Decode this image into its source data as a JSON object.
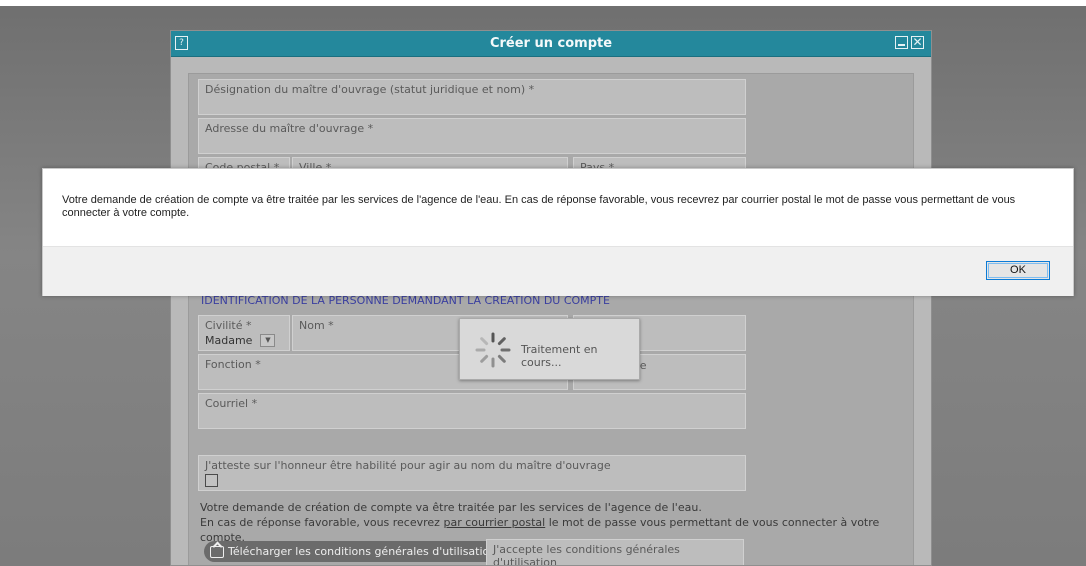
{
  "window": {
    "title": "Créer un compte",
    "help_glyph": "?",
    "close_glyph": "✕"
  },
  "form": {
    "designation_label": "Désignation du maître d'ouvrage (statut juridique et nom) *",
    "adresse_label": "Adresse du maître d'ouvrage *",
    "code_postal_label": "Code postal *",
    "ville_label": "Ville *",
    "pays_label": "Pays *",
    "section_identification": "IDENTIFICATION DE LA PERSONNE DEMANDANT LA CRÉATION DU COMPTE",
    "civilite_label": "Civilité *",
    "civilite_value": "Madame",
    "nom_label": "Nom *",
    "fonction_label": "Fonction *",
    "telephone_partial": "one",
    "courriel_label": "Courriel *",
    "attestation_label": "J'atteste sur l'honneur être habilité pour agir au nom du maître d'ouvrage",
    "notice_line1": "Votre demande de création de compte va être traitée par les services de l'agence de l'eau.",
    "notice_line2_before": "En cas de réponse favorable, vous recevrez ",
    "notice_line2_link": "par courrier postal",
    "notice_line2_after": " le mot de passe vous permettant de vous connecter à votre compte.",
    "download_button": "Télécharger les conditions générales d'utilisation",
    "accept_cgu_label": "J'accepte les conditions générales d'utilisation"
  },
  "loader": {
    "text": "Traitement en cours..."
  },
  "modal": {
    "message": "Votre demande de création de compte va être traitée par les services de l'agence de l'eau. En cas de réponse favorable, vous recevrez par courrier postal le mot de passe vous permettant de vous connecter à votre compte.",
    "ok_label": "OK"
  }
}
